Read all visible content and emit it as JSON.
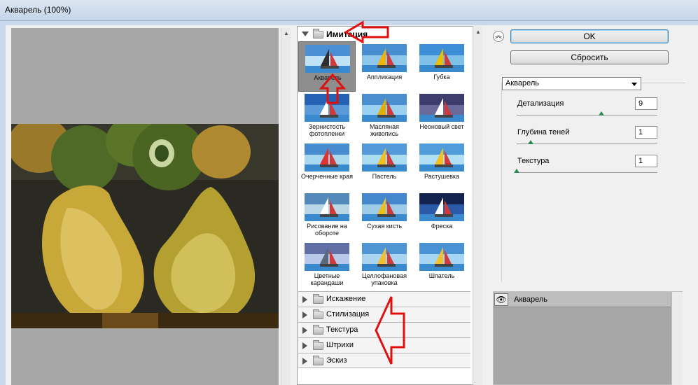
{
  "window": {
    "title": "Акварель (100%)"
  },
  "gallery": {
    "open_category": "Имитация",
    "filters": [
      {
        "label": "Акварель",
        "selected": true
      },
      {
        "label": "Аппликация"
      },
      {
        "label": "Губка"
      },
      {
        "label": "Зернистость фотопленки"
      },
      {
        "label": "Масляная живопись"
      },
      {
        "label": "Неоновый свет"
      },
      {
        "label": "Очерченные края"
      },
      {
        "label": "Пастель"
      },
      {
        "label": "Растушевка"
      },
      {
        "label": "Рисование на обороте"
      },
      {
        "label": "Сухая кисть"
      },
      {
        "label": "Фреска"
      },
      {
        "label": "Цветные карандаши"
      },
      {
        "label": "Целлофановая упаковка"
      },
      {
        "label": "Шпатель"
      }
    ],
    "closed_categories": [
      "Искажение",
      "Стилизация",
      "Текстура",
      "Штрихи",
      "Эскиз"
    ]
  },
  "buttons": {
    "ok": "OK",
    "reset": "Сбросить"
  },
  "settings": {
    "filter_select": "Акварель",
    "params": [
      {
        "label": "Детализация",
        "value": "9",
        "level": 0.6
      },
      {
        "label": "Глубина теней",
        "value": "1",
        "level": 0.1
      },
      {
        "label": "Текстура",
        "value": "1",
        "level": 0.0
      }
    ]
  },
  "layers": {
    "items": [
      "Акварель"
    ]
  },
  "colors": {
    "annotation": "#e01010",
    "handle": "#2a8a52"
  }
}
